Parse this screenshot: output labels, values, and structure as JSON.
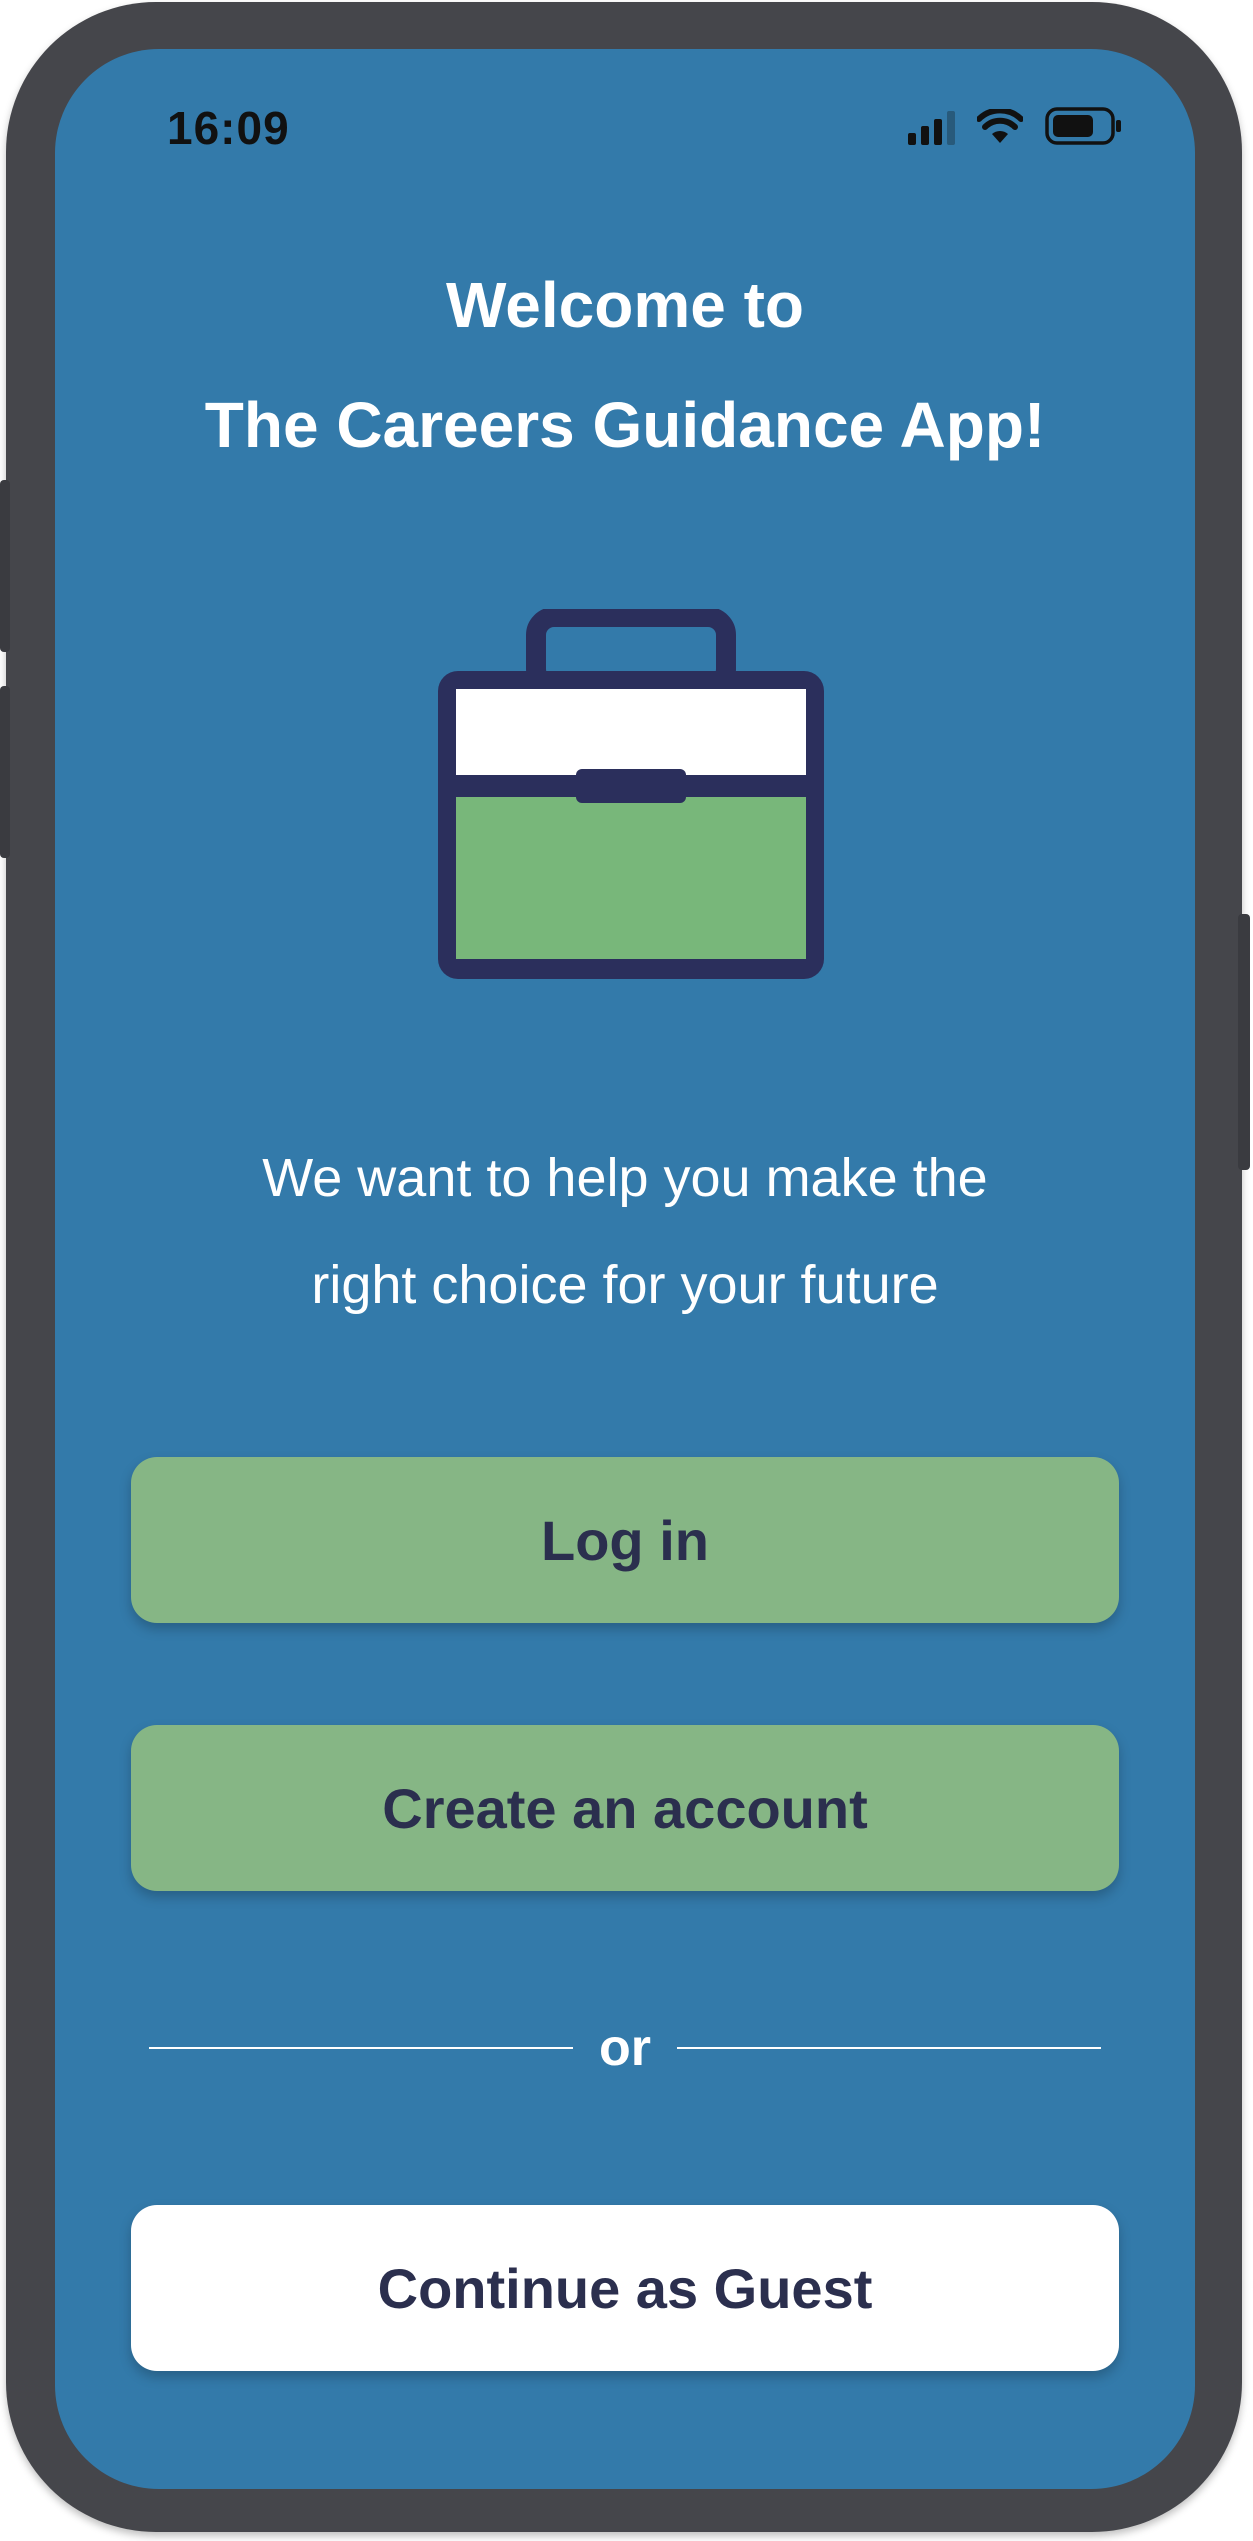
{
  "status_bar": {
    "time": "16:09",
    "icons": [
      "signal-icon",
      "wifi-icon",
      "battery-icon"
    ]
  },
  "welcome": {
    "line1": "Welcome to",
    "line2": "The Careers Guidance App!"
  },
  "illustration": {
    "icon": "briefcase-icon",
    "colors": {
      "outline": "#2b2f5c",
      "top": "#ffffff",
      "body": "#78b77a"
    }
  },
  "tagline": {
    "line1": "We want to help you make the",
    "line2": "right choice for your future"
  },
  "actions": {
    "login_label": "Log in",
    "create_label": "Create an account",
    "divider_label": "or",
    "guest_label": "Continue as Guest"
  },
  "colors": {
    "background": "#337aaa",
    "primary_button": "#86b685",
    "secondary_button": "#ffffff",
    "button_text": "#2b2f4e",
    "frame": "#45464b"
  }
}
